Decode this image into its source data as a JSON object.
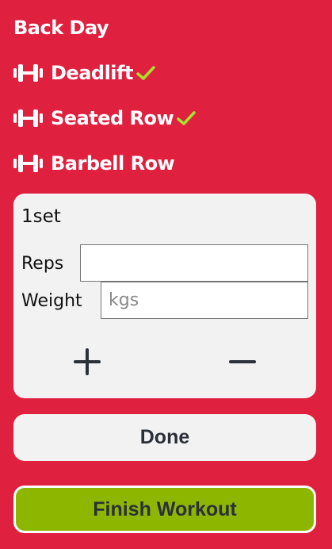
{
  "workout": {
    "title": "Back Day"
  },
  "exercises": [
    {
      "label": "Deadlift",
      "icon": "dumbbell-icon",
      "completed": true
    },
    {
      "label": "Seated Row",
      "icon": "dumbbell-icon",
      "completed": true
    },
    {
      "label": "Barbell Row",
      "icon": "dumbbell-icon",
      "completed": false
    }
  ],
  "set_card": {
    "set_label": "1set",
    "reps_label": "Reps",
    "reps_value": "",
    "weight_label": "Weight",
    "weight_value": "",
    "weight_placeholder": "kgs",
    "add_icon": "plus-icon",
    "remove_icon": "minus-icon"
  },
  "actions": {
    "done_label": "Done",
    "finish_label": "Finish Workout"
  },
  "colors": {
    "background": "#e0203f",
    "card": "#f2f2f2",
    "check": "#a6e22e",
    "finish_button": "#8db600",
    "button_text": "#2b3039"
  }
}
